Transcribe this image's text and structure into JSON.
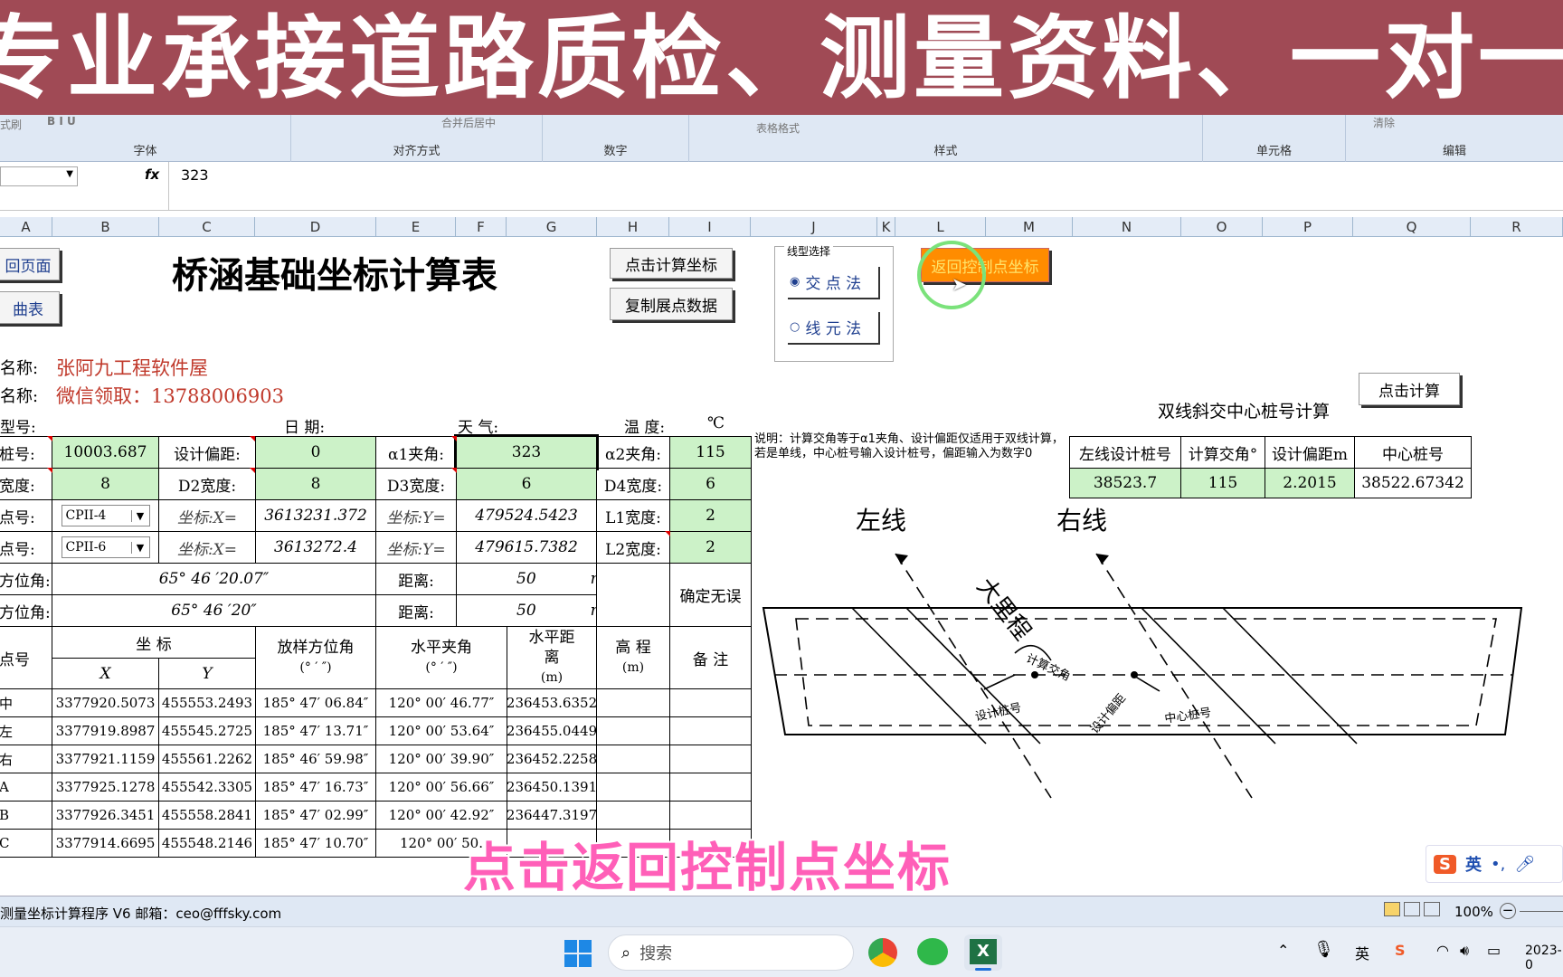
{
  "banner": {
    "text": "专业承接道路质检、测量资料、一对一教学等"
  },
  "ribbon": {
    "groups": [
      "字体",
      "对齐方式",
      "数字",
      "样式",
      "单元格",
      "编辑"
    ],
    "faint_left": "式刷",
    "merge_center": "合并后居中",
    "table_format": "表格格式",
    "clear": "清除"
  },
  "formula_bar": {
    "value": "323",
    "fx": "fx"
  },
  "columns": [
    "A",
    "B",
    "C",
    "D",
    "E",
    "F",
    "G",
    "H",
    "I",
    "J",
    "K",
    "L",
    "M",
    "N",
    "O",
    "P",
    "Q",
    "R"
  ],
  "sheet": {
    "btn_home": "回页面",
    "btn_curve": "曲表",
    "title": "桥涵基础坐标计算表",
    "btn_calc": "点击计算坐标",
    "btn_copy": "复制展点数据",
    "line_type": {
      "legend": "线型选择",
      "opt1": "交 点 法",
      "opt2": "线 元 法"
    },
    "btn_return": "返回控制点坐标",
    "name_label1": "名称:",
    "name_value1": "张阿九工程软件屋",
    "name_label2": "名称:",
    "name_value2": "微信领取：13788006903",
    "type_label": "型号:",
    "date_label": "日  期:",
    "weather_label": "天  气:",
    "temp_label": "温  度:",
    "temp_unit": "℃",
    "dual_title": "双线斜交中心桩号计算",
    "btn_dual_calc": "点击计算",
    "note": "说明：计算交角等于α1夹角、设计偏距仅适用于双线计算，若是单线，中心桩号输入设计桩号，偏距输入为数字0",
    "dual_headers": [
      "左线设计桩号",
      "计算交角°",
      "设计偏距m",
      "中心桩号"
    ],
    "dual_values": [
      "38523.7",
      "115",
      "2.2015",
      "38522.67342"
    ],
    "row1": {
      "a": "桩号:",
      "b": "10003.687",
      "c": "设计偏距:",
      "d": "0",
      "e": "α1夹角:",
      "g": "323",
      "h": "α2夹角:",
      "i": "115"
    },
    "row2": {
      "a": "宽度:",
      "b": "8",
      "c": "D2宽度:",
      "d": "8",
      "e": "D3宽度:",
      "g": "6",
      "h": "D4宽度:",
      "i": "6"
    },
    "row3": {
      "a": "点号:",
      "b": "CPII-4",
      "c": "坐标:X=",
      "d": "3613231.372",
      "e": "坐标:Y=",
      "g": "479524.5423",
      "h": "L1宽度:",
      "i": "2"
    },
    "row4": {
      "a": "点号:",
      "b": "CPII-6",
      "c": "坐标:X=",
      "d": "3613272.4",
      "e": "坐标:Y=",
      "g": "479615.7382",
      "h": "L2宽度:",
      "i": "2"
    },
    "row5": {
      "a": "方位角:",
      "b": "65° 46 ′20.07″",
      "e": "距离:",
      "g": "50",
      "gu": "m"
    },
    "row6": {
      "a": "方位角:",
      "b": "65° 46 ′20″",
      "e": "距离:",
      "g": "50",
      "gu": "m"
    },
    "confirm": "确定无误",
    "table_headers": {
      "point": "点号",
      "coord": "坐  标",
      "x": "X",
      "y": "Y",
      "azimuth": "放样方位角",
      "azimuth_unit": "(° ′ ″)",
      "hangle": "水平夹角",
      "hangle_unit": "(° ′ ″)",
      "hdist": "水平距离",
      "hdist_unit": "(m)",
      "elev": "高  程",
      "elev_unit": "(m)",
      "remark": "备  注"
    },
    "rows": [
      {
        "p": "中",
        "x": "3377920.5073",
        "y": "455553.2493",
        "az": "185° 47′ 06.84″",
        "ha": "120° 00′ 46.77″",
        "hd": "236453.6352"
      },
      {
        "p": "左",
        "x": "3377919.8987",
        "y": "455545.2725",
        "az": "185° 47′ 13.71″",
        "ha": "120° 00′ 53.64″",
        "hd": "236455.0449"
      },
      {
        "p": "右",
        "x": "3377921.1159",
        "y": "455561.2262",
        "az": "185° 46′ 59.98″",
        "ha": "120° 00′ 39.90″",
        "hd": "236452.2258"
      },
      {
        "p": "A",
        "x": "3377925.1278",
        "y": "455542.3305",
        "az": "185° 47′ 16.73″",
        "ha": "120° 00′ 56.66″",
        "hd": "236450.1391"
      },
      {
        "p": "B",
        "x": "3377926.3451",
        "y": "455558.2841",
        "az": "185° 47′ 02.99″",
        "ha": "120° 00′ 42.92″",
        "hd": "236447.3197"
      },
      {
        "p": "C",
        "x": "3377914.6695",
        "y": "455548.2146",
        "az": "185° 47′ 10.70″",
        "ha": "120° 00′ 50.",
        "hd": ""
      }
    ],
    "diagram": {
      "left_line": "左线",
      "right_line": "右线",
      "big_mileage": "大里程",
      "calc_angle": "计算交角",
      "design_station": "设计桩号",
      "center_station": "中心桩号",
      "design_offset": "设计偏距"
    }
  },
  "status_bar": {
    "text": "测量坐标计算程序 V6  邮箱：ceo@fffsky.com",
    "zoom": "100%"
  },
  "taskbar": {
    "search": "搜索",
    "ime": "英",
    "clock": "2023-0"
  },
  "subtitle": "点击返回控制点坐标",
  "colors": {
    "banner": "#a04a55",
    "green_cell": "#ccf2c8",
    "orange_button": "#ff8c00",
    "subtitle": "#ff5fb8",
    "red_text": "#c0392b"
  }
}
